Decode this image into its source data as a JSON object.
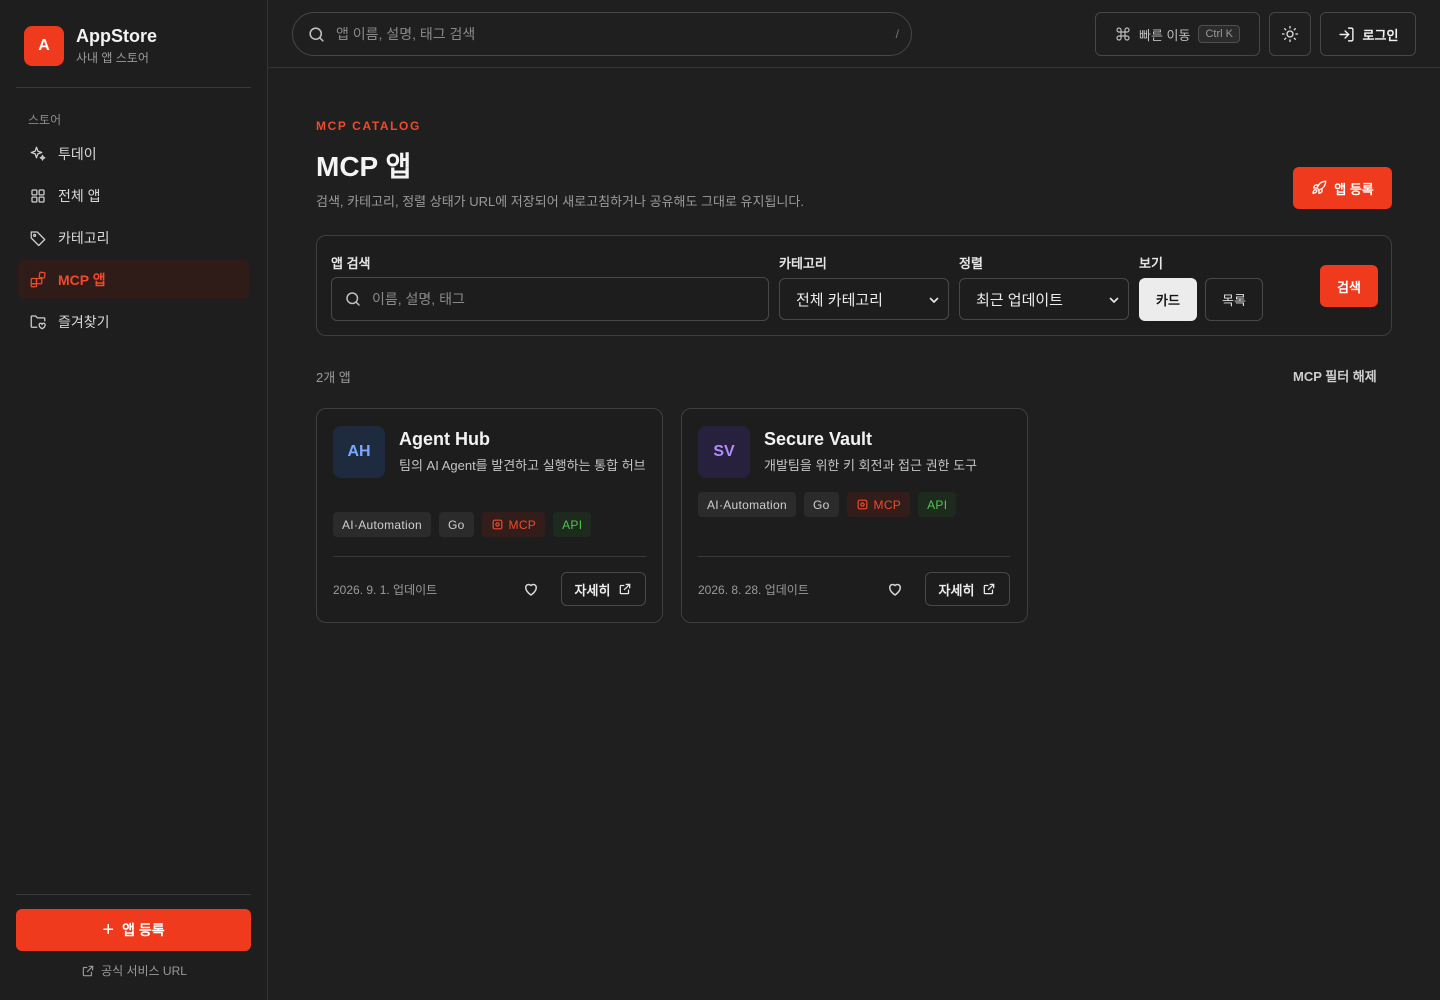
{
  "app": {
    "logo_letter": "A",
    "name": "AppStore",
    "subtitle": "사내 앱 스토어",
    "accent": "#ef3a1d"
  },
  "sidebar": {
    "section_label": "스토어",
    "items": [
      {
        "label": "투데이",
        "icon": "sparkles-icon",
        "active": false
      },
      {
        "label": "전체 앱",
        "icon": "grid-icon",
        "active": false
      },
      {
        "label": "카테고리",
        "icon": "tag-icon",
        "active": false
      },
      {
        "label": "MCP 앱",
        "icon": "blocks-icon",
        "active": true
      },
      {
        "label": "즐겨찾기",
        "icon": "folder-heart-icon",
        "active": false
      }
    ],
    "cta_icon": "+",
    "cta_label": "앱 등록",
    "link_label": "공식 서비스 URL"
  },
  "topbar": {
    "search_placeholder": "앱 이름, 설명, 태그 검색",
    "search_shortcut": "/",
    "quick_label": "빠른 이동",
    "quick_kbd": "Ctrl K",
    "login_label": "로그인"
  },
  "page": {
    "eyebrow": "MCP CATALOG",
    "title": "MCP 앱",
    "description": "검색, 카테고리, 정렬 상태가 URL에 저장되어 새로고침하거나 공유해도 그대로 유지됩니다.",
    "register_label": "앱 등록"
  },
  "filters": {
    "search_label": "앱 검색",
    "search_placeholder": "이름, 설명, 태그",
    "category_label": "카테고리",
    "category_value": "전체 카테고리",
    "sort_label": "정렬",
    "sort_value": "최근 업데이트",
    "view_label": "보기",
    "view_card": "카드",
    "view_list": "목록",
    "selected_view": "카드",
    "search_button": "검색"
  },
  "results": {
    "count_text": "2개 앱",
    "clear_label": "MCP 필터 해제"
  },
  "apps": [
    {
      "initials": "AH",
      "avatar_bg": "#1e2a3d",
      "avatar_color": "#7aa7ff",
      "name": "Agent Hub",
      "description": "팀의 AI Agent를 발견하고 실행하는 통합 허브",
      "tags": [
        "AI·Automation",
        "Go",
        "MCP",
        "API"
      ],
      "updated": "2026. 9. 1. 업데이트",
      "detail_label": "자세히"
    },
    {
      "initials": "SV",
      "avatar_bg": "#28213d",
      "avatar_color": "#b08cff",
      "name": "Secure Vault",
      "description": "개발팀을 위한 키 회전과 접근 권한 도구",
      "tags": [
        "AI·Automation",
        "Go",
        "MCP",
        "API"
      ],
      "updated": "2026. 8. 28. 업데이트",
      "detail_label": "자세히"
    }
  ]
}
